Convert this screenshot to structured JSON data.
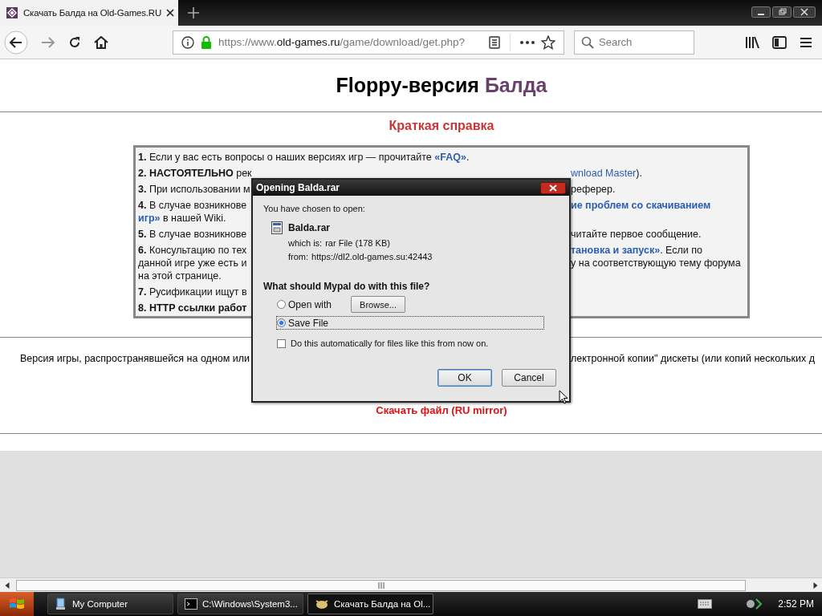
{
  "browser": {
    "tab": {
      "title": "Скачать Балда на Old-Games.RU",
      "selected": true
    },
    "address": {
      "scheme": "https://www.",
      "domain": "old-games.ru",
      "path": "/game/download/get.php?"
    },
    "search": {
      "placeholder": "Search"
    }
  },
  "page": {
    "title": {
      "prefix": "Floppy-версия",
      "name": "Балда"
    },
    "section_title": "Краткая справка",
    "notes": [
      {
        "lines": [
          {
            "kind": "full",
            "full": [
              {
                "kind": "text",
                "text": "**1.** Если у вас есть вопросы о наших версиях игр — прочитайте "
              },
              {
                "kind": "strong-link",
                "text": "«FAQ»"
              },
              {
                "kind": "text",
                "text": "."
              }
            ]
          }
        ]
      },
      {
        "lines": [
          {
            "kind": "split",
            "left": [
              {
                "kind": "text",
                "text": "**2. НАСТОЯТЕЛЬНО** рек"
              }
            ],
            "right": [
              {
                "kind": "link",
                "text": "wnload Master"
              },
              {
                "kind": "text",
                "text": ")."
              }
            ]
          }
        ]
      },
      {
        "lines": [
          {
            "kind": "split",
            "left": [
              {
                "kind": "text",
                "text": "**3.** При использовании м"
              }
            ],
            "right": [
              {
                "kind": "text",
                "text": "реферер."
              }
            ]
          }
        ]
      },
      {
        "lines": [
          {
            "kind": "split",
            "left": [
              {
                "kind": "text",
                "text": "**4.** В случае возникнове"
              }
            ],
            "right": [
              {
                "kind": "strong-link",
                "text": "ие проблем со скачиванием"
              }
            ]
          },
          {
            "kind": "full",
            "full": [
              {
                "kind": "strong-link",
                "text": "игр»"
              },
              {
                "kind": "text",
                "text": " в нашей Wiki."
              }
            ]
          }
        ]
      },
      {
        "lines": [
          {
            "kind": "split",
            "left": [
              {
                "kind": "text",
                "text": "**5.** В случае возникнове"
              }
            ],
            "right": [
              {
                "kind": "text",
                "text": "читайте первое сообщение."
              }
            ]
          }
        ]
      },
      {
        "lines": [
          {
            "kind": "split",
            "left": [
              {
                "kind": "text",
                "text": "**6.** Консультацию по тех"
              }
            ],
            "right": [
              {
                "kind": "strong-link",
                "text": "тановка и запуск»"
              },
              {
                "kind": "text",
                "text": ". Если по"
              }
            ]
          },
          {
            "kind": "split",
            "left": [
              {
                "kind": "text",
                "text": "данной игре уже есть и"
              }
            ],
            "right": [
              {
                "kind": "text",
                "text": "у на соответствующую тему форума"
              }
            ]
          },
          {
            "kind": "full",
            "full": [
              {
                "kind": "text",
                "text": "на этой странице."
              }
            ]
          }
        ]
      },
      {
        "lines": [
          {
            "kind": "split",
            "left": [
              {
                "kind": "text",
                "text": "**7.** Русификации ищут в"
              }
            ]
          }
        ]
      },
      {
        "lines": [
          {
            "kind": "split",
            "left": [
              {
                "kind": "text",
                "text": "**8. HTTP ссылки работ**"
              }
            ]
          }
        ]
      }
    ],
    "description": {
      "left": "Версия игры, распространявшейся на одном или",
      "right": "лектронной копии\" дискеты (или копий нескольких д"
    },
    "download_link": "Скачать файл (RU mirror)"
  },
  "dialog": {
    "title": "Opening Balda.rar",
    "intro": "You have chosen to open:",
    "file_name": "Balda.rar",
    "type_label": "which is:",
    "type_value": "rar File (178 KB)",
    "from_label": "from:",
    "from_value": "https://dl2.old-games.su:42443",
    "question": "What should Mypal do with this file?",
    "options": [
      {
        "kind": "with-button",
        "label": "Open with",
        "button": "Browse...",
        "selected": false
      },
      {
        "kind": "plain",
        "label": "Save File",
        "selected": true
      }
    ],
    "auto": {
      "label": "Do this automatically for files like this from now on.",
      "checked": false
    },
    "buttons": [
      {
        "label": "OK",
        "default": true
      },
      {
        "label": "Cancel",
        "default": false
      }
    ]
  },
  "taskbar": {
    "items": [
      {
        "kind": "computer",
        "label": "My Computer",
        "selected": false
      },
      {
        "kind": "console",
        "label": "C:\\Windows\\System3...",
        "selected": false
      },
      {
        "kind": "browser",
        "label": "Скачать Балда на Ol...",
        "selected": true
      }
    ],
    "clock": "2:52 PM"
  }
}
